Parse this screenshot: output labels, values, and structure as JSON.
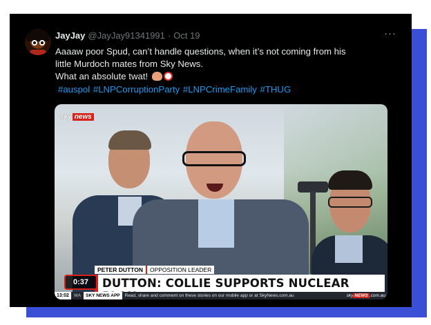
{
  "tweet": {
    "display_name": "JayJay",
    "handle": "@JayJay91341991",
    "separator": "·",
    "date": "Oct 19",
    "more_label": "···",
    "text_line_1": "Aaaaw poor Spud, can’t handle questions,  when it’s not coming from his",
    "text_line_2": "little Murdoch mates from Sky News.",
    "text_line_3": "What an absolute twat!",
    "hashtags": "#auspol #LNPCorruptionParty #LNPCrimeFamily #THUG"
  },
  "video": {
    "logo_sky": "sky",
    "logo_news": "news",
    "name_strap": "PETER DUTTON",
    "role_strap": "OPPOSITION LEADER",
    "headline": "DUTTON: COLLIE SUPPORTS NUCLEAR PLAN",
    "duration": "0:37",
    "ticker_time": "13:02",
    "ticker_region": "WA",
    "ticker_app": "SKY NEWS APP",
    "ticker_text": "Read, share and comment on these stories on our mobile app or at SkyNews.com.au",
    "ticker_logo_sky": "sky",
    "ticker_logo_news": "NEWS",
    "ticker_logo_suffix": ".com.au"
  },
  "colors": {
    "shadow": "#3b4fd6",
    "card": "#000000",
    "hashtag": "#1d9bf0",
    "sky_red": "#d62218"
  },
  "icons": [
    "avatar",
    "peanut-emoji-icon",
    "clown-emoji-icon",
    "more-icon"
  ]
}
